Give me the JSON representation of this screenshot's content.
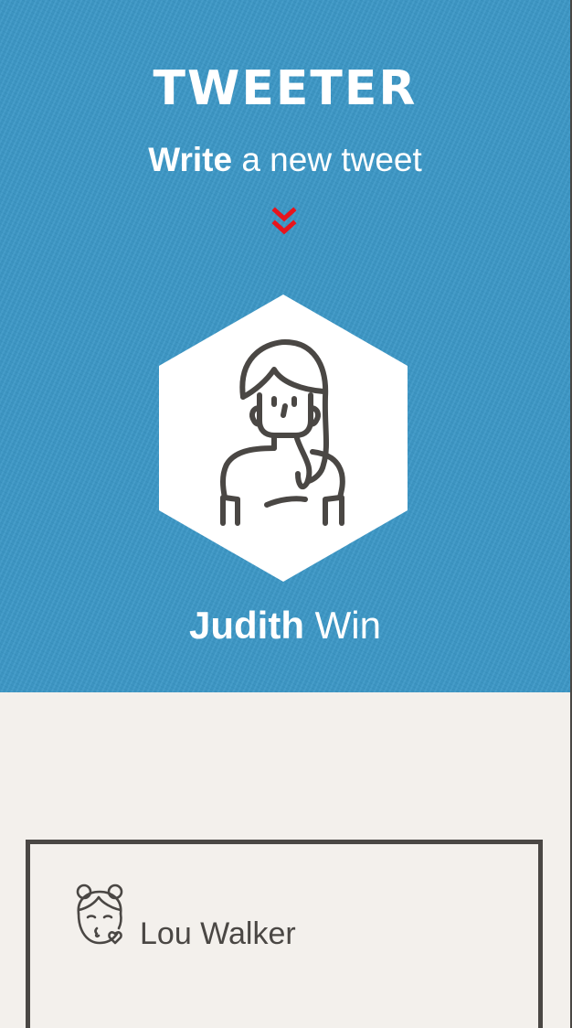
{
  "header": {
    "app_title": "TWEETER",
    "subtitle_bold": "Write",
    "subtitle_rest": " a new tweet",
    "scroll_icon": "double-chevron-down-icon"
  },
  "profile": {
    "avatar_icon": "woman-avatar-icon",
    "first_name": "Judith",
    "last_name": " Win"
  },
  "tweets": [
    {
      "author_name": "Lou Walker",
      "avatar_icon": "girl-kiss-avatar-icon"
    }
  ],
  "colors": {
    "hero_blue": "#3b97c6",
    "page_bg": "#f3f0ec",
    "accent_red": "#e8141c",
    "ink": "#4a4744",
    "white": "#ffffff"
  }
}
